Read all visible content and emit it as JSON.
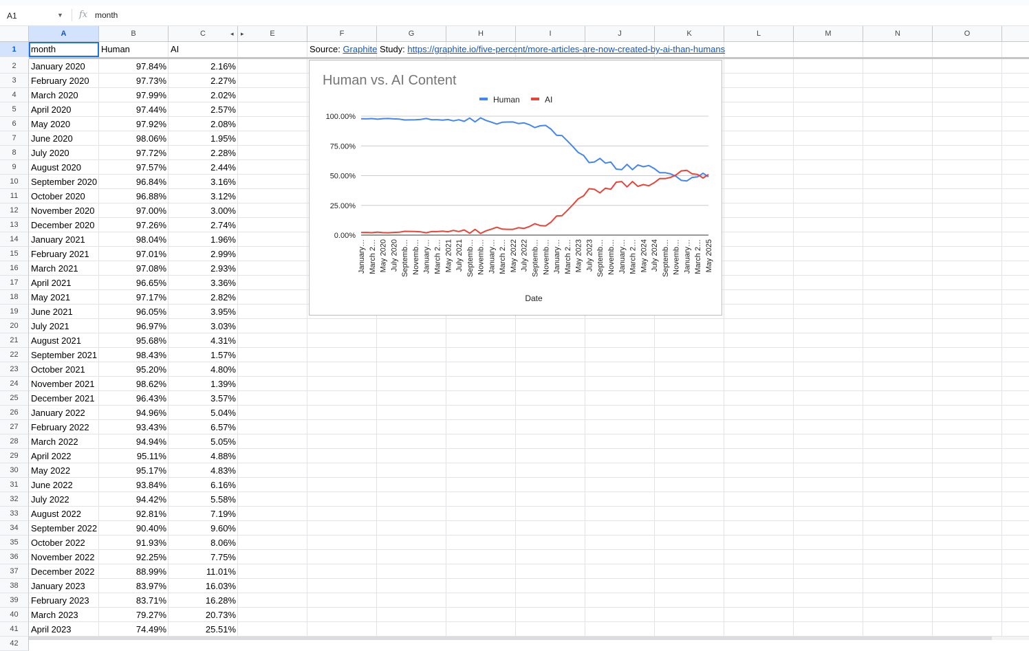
{
  "namebox": {
    "ref": "A1"
  },
  "formula": {
    "value": "month"
  },
  "columns": [
    "A",
    "B",
    "C",
    "E",
    "F",
    "G",
    "H",
    "I",
    "J",
    "K",
    "L",
    "M",
    "N",
    "O"
  ],
  "header_row": {
    "a": "month",
    "b": "Human",
    "c": "AI"
  },
  "source": {
    "label": "Source:",
    "link_text": "Graphite",
    "study_label": "Study:",
    "study_url": "https://graphite.io/five-percent/more-articles-are-now-created-by-ai-than-humans"
  },
  "rows": [
    [
      "January 2020",
      "97.84%",
      "2.16%"
    ],
    [
      "February 2020",
      "97.73%",
      "2.27%"
    ],
    [
      "March 2020",
      "97.99%",
      "2.02%"
    ],
    [
      "April 2020",
      "97.44%",
      "2.57%"
    ],
    [
      "May 2020",
      "97.92%",
      "2.08%"
    ],
    [
      "June 2020",
      "98.06%",
      "1.95%"
    ],
    [
      "July 2020",
      "97.72%",
      "2.28%"
    ],
    [
      "August 2020",
      "97.57%",
      "2.44%"
    ],
    [
      "September 2020",
      "96.84%",
      "3.16%"
    ],
    [
      "October 2020",
      "96.88%",
      "3.12%"
    ],
    [
      "November 2020",
      "97.00%",
      "3.00%"
    ],
    [
      "December 2020",
      "97.26%",
      "2.74%"
    ],
    [
      "January 2021",
      "98.04%",
      "1.96%"
    ],
    [
      "February 2021",
      "97.01%",
      "2.99%"
    ],
    [
      "March 2021",
      "97.08%",
      "2.93%"
    ],
    [
      "April 2021",
      "96.65%",
      "3.36%"
    ],
    [
      "May 2021",
      "97.17%",
      "2.82%"
    ],
    [
      "June 2021",
      "96.05%",
      "3.95%"
    ],
    [
      "July 2021",
      "96.97%",
      "3.03%"
    ],
    [
      "August 2021",
      "95.68%",
      "4.31%"
    ],
    [
      "September 2021",
      "98.43%",
      "1.57%"
    ],
    [
      "October 2021",
      "95.20%",
      "4.80%"
    ],
    [
      "November 2021",
      "98.62%",
      "1.39%"
    ],
    [
      "December 2021",
      "96.43%",
      "3.57%"
    ],
    [
      "January 2022",
      "94.96%",
      "5.04%"
    ],
    [
      "February 2022",
      "93.43%",
      "6.57%"
    ],
    [
      "March 2022",
      "94.94%",
      "5.05%"
    ],
    [
      "April 2022",
      "95.11%",
      "4.88%"
    ],
    [
      "May 2022",
      "95.17%",
      "4.83%"
    ],
    [
      "June 2022",
      "93.84%",
      "6.16%"
    ],
    [
      "July 2022",
      "94.42%",
      "5.58%"
    ],
    [
      "August 2022",
      "92.81%",
      "7.19%"
    ],
    [
      "September 2022",
      "90.40%",
      "9.60%"
    ],
    [
      "October 2022",
      "91.93%",
      "8.06%"
    ],
    [
      "November 2022",
      "92.25%",
      "7.75%"
    ],
    [
      "December 2022",
      "88.99%",
      "11.01%"
    ],
    [
      "January 2023",
      "83.97%",
      "16.03%"
    ],
    [
      "February 2023",
      "83.71%",
      "16.28%"
    ],
    [
      "March 2023",
      "79.27%",
      "20.73%"
    ],
    [
      "April 2023",
      "74.49%",
      "25.51%"
    ]
  ],
  "chart_data": {
    "type": "line",
    "title": "Human vs. AI Content",
    "xlabel": "Date",
    "ylabel": "",
    "ylim": [
      0,
      100
    ],
    "yticks": [
      "0.00%",
      "25.00%",
      "50.00%",
      "75.00%",
      "100.00%"
    ],
    "legend_position": "top",
    "x_tick_labels": [
      "January…",
      "March 2…",
      "May 2020",
      "July 2020",
      "Septemb…",
      "Novemb…",
      "January…",
      "March 2…",
      "May 2021",
      "July 2021",
      "Septemb…",
      "Novemb…",
      "January…",
      "March 2…",
      "May 2022",
      "July 2022",
      "Septemb…",
      "Novemb…",
      "January…",
      "March 2…",
      "May 2023",
      "July 2023",
      "Septemb…",
      "Novemb…",
      "January…",
      "March 2…",
      "May 2024",
      "July 2024",
      "Septemb…",
      "Novemb…",
      "January…",
      "March 2…",
      "May 2025"
    ],
    "series": [
      {
        "name": "Human",
        "color": "#4285f4",
        "values": [
          97.84,
          97.73,
          97.99,
          97.44,
          97.92,
          98.06,
          97.72,
          97.57,
          96.84,
          96.88,
          97.0,
          97.26,
          98.04,
          97.01,
          97.08,
          96.65,
          97.17,
          96.05,
          96.97,
          95.68,
          98.43,
          95.2,
          98.62,
          96.43,
          94.96,
          93.43,
          94.94,
          95.11,
          95.17,
          93.84,
          94.42,
          92.81,
          90.4,
          91.93,
          92.25,
          88.99,
          83.97,
          83.71,
          79.27,
          74.49,
          69.5,
          67.0,
          61.0,
          61.5,
          64.5,
          60.5,
          61.5,
          55.5,
          55.0,
          59.5,
          55.0,
          59.0,
          57.5,
          58.5,
          56.0,
          52.5,
          52.5,
          51.5,
          49.5,
          46.0,
          45.5,
          48.5,
          49.0,
          52.0,
          49.0
        ]
      },
      {
        "name": "AI",
        "color": "#ea4335",
        "values": [
          2.16,
          2.27,
          2.02,
          2.57,
          2.08,
          1.95,
          2.28,
          2.44,
          3.16,
          3.12,
          3.0,
          2.74,
          1.96,
          2.99,
          2.93,
          3.36,
          2.82,
          3.95,
          3.03,
          4.31,
          1.57,
          4.8,
          1.39,
          3.57,
          5.04,
          6.57,
          5.05,
          4.88,
          4.83,
          6.16,
          5.58,
          7.19,
          9.6,
          8.06,
          7.75,
          11.01,
          16.03,
          16.28,
          20.73,
          25.51,
          30.5,
          33.0,
          39.0,
          38.5,
          35.5,
          39.5,
          38.5,
          44.5,
          45.0,
          40.5,
          45.0,
          41.0,
          42.5,
          41.5,
          44.0,
          47.5,
          47.5,
          48.5,
          50.5,
          54.0,
          54.5,
          51.5,
          51.0,
          48.0,
          51.0
        ]
      }
    ]
  }
}
